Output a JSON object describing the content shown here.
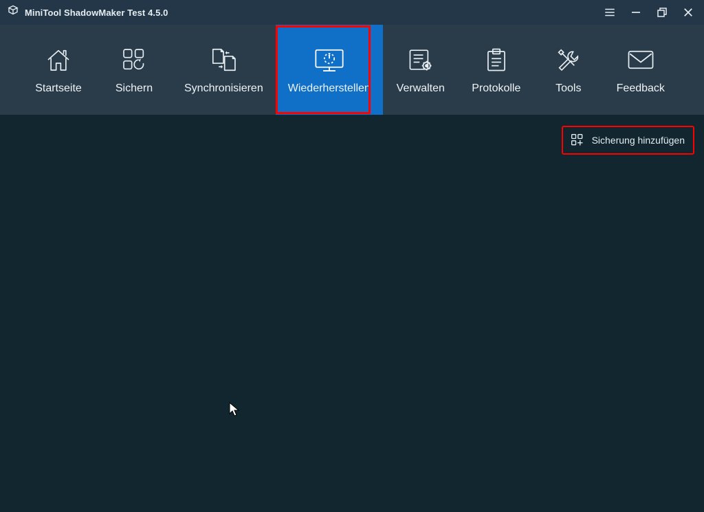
{
  "app": {
    "title": "MiniTool ShadowMaker Test 4.5.0"
  },
  "nav": {
    "items": [
      {
        "label": "Startseite"
      },
      {
        "label": "Sichern"
      },
      {
        "label": "Synchronisieren"
      },
      {
        "label": "Wiederherstellen",
        "active": true
      },
      {
        "label": "Verwalten"
      },
      {
        "label": "Protokolle"
      },
      {
        "label": "Tools"
      },
      {
        "label": "Feedback"
      }
    ]
  },
  "buttons": {
    "add_backup": "Sicherung hinzufügen"
  }
}
